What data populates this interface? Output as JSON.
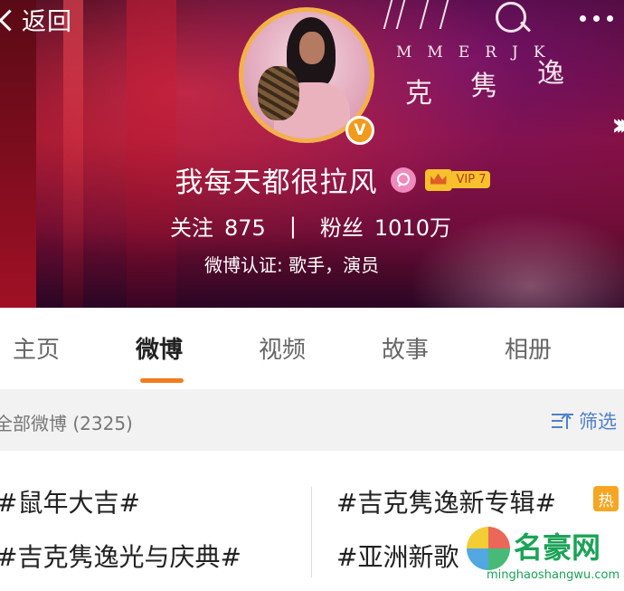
{
  "header": {
    "back_label": "返回",
    "cover_art": {
      "letters": "MMERJK",
      "chars": [
        "克",
        "隽",
        "逸"
      ]
    }
  },
  "profile": {
    "username": "我每天都很拉风",
    "vip_label": "VIP 7",
    "verified_mark": "V",
    "following_label": "关注",
    "following_count": "875",
    "separator": "|",
    "followers_label": "粉丝",
    "followers_count": "1010万",
    "verification": "微博认证: 歌手，演员"
  },
  "tabs": [
    {
      "label": "主页",
      "active": false
    },
    {
      "label": "微博",
      "active": true
    },
    {
      "label": "视频",
      "active": false
    },
    {
      "label": "故事",
      "active": false
    },
    {
      "label": "相册",
      "active": false
    }
  ],
  "filter": {
    "label": "全部微博 (2325)",
    "button_label": "筛选"
  },
  "topics": [
    {
      "text": "#鼠年大吉#"
    },
    {
      "text": "#吉克隽逸光与庆典#"
    },
    {
      "text": "#吉克隽逸新专辑#",
      "badge": "热"
    },
    {
      "text": "#亚洲新歌"
    }
  ],
  "watermark": {
    "title": "名豪网",
    "url": "minghaoshangwu.com"
  },
  "colors": {
    "accent": "#f37c1e",
    "link": "#4f80c8",
    "avatar_ring": "#f3b14a",
    "hot_badge": "#f6a623"
  }
}
